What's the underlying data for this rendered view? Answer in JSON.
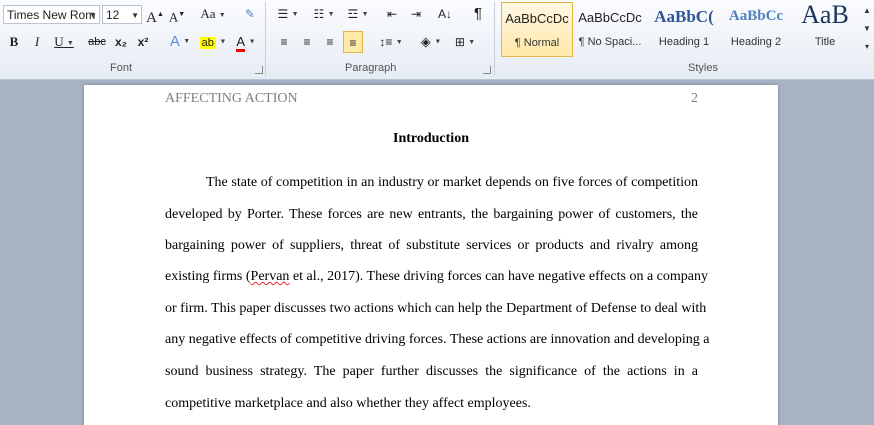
{
  "ribbon": {
    "font_group": {
      "label": "Font",
      "font_name": "Times New Rom",
      "font_size": "12",
      "grow_font": "A",
      "shrink_font": "A",
      "change_case": "Aa",
      "bold": "B",
      "italic": "I",
      "underline": "U",
      "strikethrough": "abc",
      "subscript": "x₂",
      "superscript": "x²",
      "text_effects": "A",
      "font_color": "A"
    },
    "paragraph_group": {
      "label": "Paragraph",
      "show_marks": "¶"
    },
    "styles_group": {
      "label": "Styles",
      "tiles": [
        {
          "sample": "AaBbCcDc",
          "name": "¶ Normal",
          "selected": true
        },
        {
          "sample": "AaBbCcDc",
          "name": "¶ No Spaci..."
        },
        {
          "sample": "AaBbC(",
          "name": "Heading 1",
          "color": "#2f5597"
        },
        {
          "sample": "AaBbCc",
          "name": "Heading 2",
          "color": "#4f81bd"
        },
        {
          "sample": "AaB",
          "name": "Title",
          "color": "#17365d"
        }
      ]
    }
  },
  "document": {
    "header_left": "AFFECTING ACTION",
    "header_right": "2",
    "heading": "Introduction",
    "lines": [
      "The state of competition in an industry or market depends on five forces of competition",
      "developed by Porter. These forces are new entrants, the bargaining power of customers, the",
      "bargaining power of suppliers, threat of substitute services or products and rivalry among",
      "existing firms (Pervan et al., 2017). These driving forces can have negative effects on a company",
      "or firm. This paper discusses two actions which can help the Department of Defense to deal with",
      "any negative effects of competitive driving forces. These actions are innovation and developing a",
      "sound business strategy. The paper further discusses the significance of the actions in a",
      "competitive marketplace and also whether they affect employees."
    ],
    "line4_prefix": "existing firms (",
    "line4_squiggle": "Pervan",
    "line4_suffix": " et al., 2017). These driving forces can have negative effects on a company"
  }
}
